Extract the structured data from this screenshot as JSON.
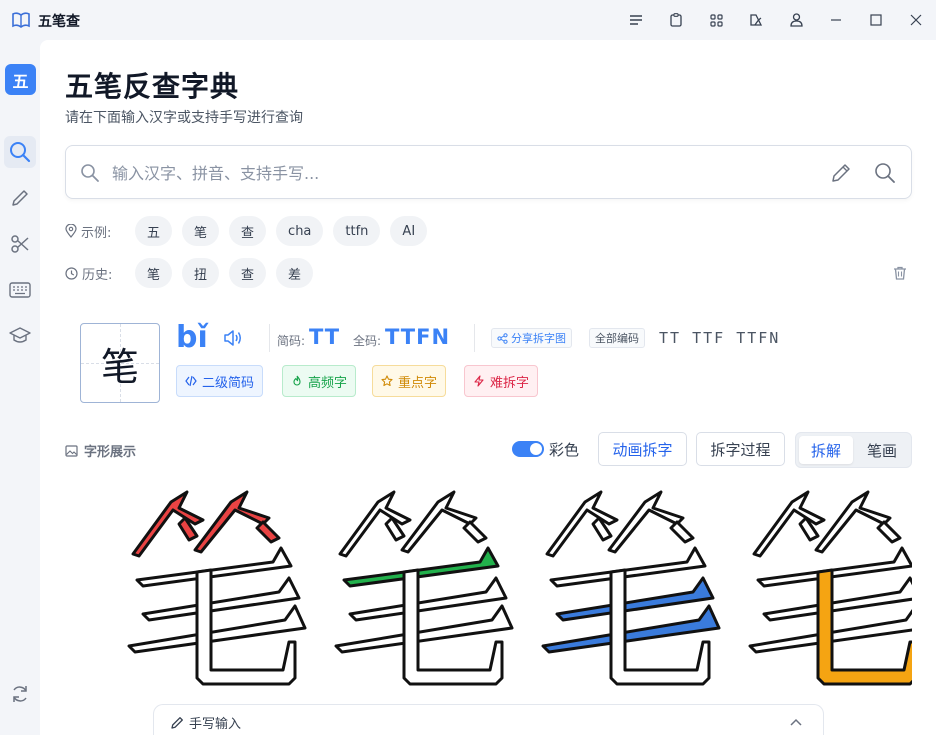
{
  "window": {
    "title": "五笔查"
  },
  "sidebar": {
    "logo_text": "五"
  },
  "header": {
    "title": "五笔反查字典",
    "subtitle": "请在下面输入汉字或支持手写进行查询"
  },
  "search": {
    "placeholder": "输入汉字、拼音、支持手写..."
  },
  "examples": {
    "label": "示例:",
    "items": [
      "五",
      "笔",
      "查",
      "cha",
      "ttfn",
      "AI"
    ]
  },
  "history": {
    "label": "历史:",
    "items": [
      "笔",
      "扭",
      "查",
      "差"
    ]
  },
  "character": {
    "char": "笔",
    "pinyin": "bǐ",
    "short_code_label": "简码:",
    "short_code": "TT",
    "full_code_label": "全码:",
    "full_code": "TTFN",
    "share_label": "分享拆字图",
    "all_codes_label": "全部编码",
    "all_codes": "TT  TTF  TTFN",
    "tags": [
      {
        "label": "二级简码",
        "color": "#2563eb"
      },
      {
        "label": "高频字",
        "color": "#16a34a"
      },
      {
        "label": "重点字",
        "color": "#d08a06"
      },
      {
        "label": "难拆字",
        "color": "#dc2647"
      }
    ]
  },
  "glyph_display": {
    "section_label": "字形展示",
    "color_toggle_label": "彩色",
    "color_toggle_on": true,
    "animate_label": "动画拆字",
    "process_label": "拆字过程",
    "segments": [
      "拆解",
      "笔画"
    ],
    "active_segment": "拆解",
    "root_colors": [
      "#e94343",
      "#22b14c",
      "#3a7bdc",
      "#f5a412"
    ]
  },
  "handwriting": {
    "label": "手写输入"
  }
}
